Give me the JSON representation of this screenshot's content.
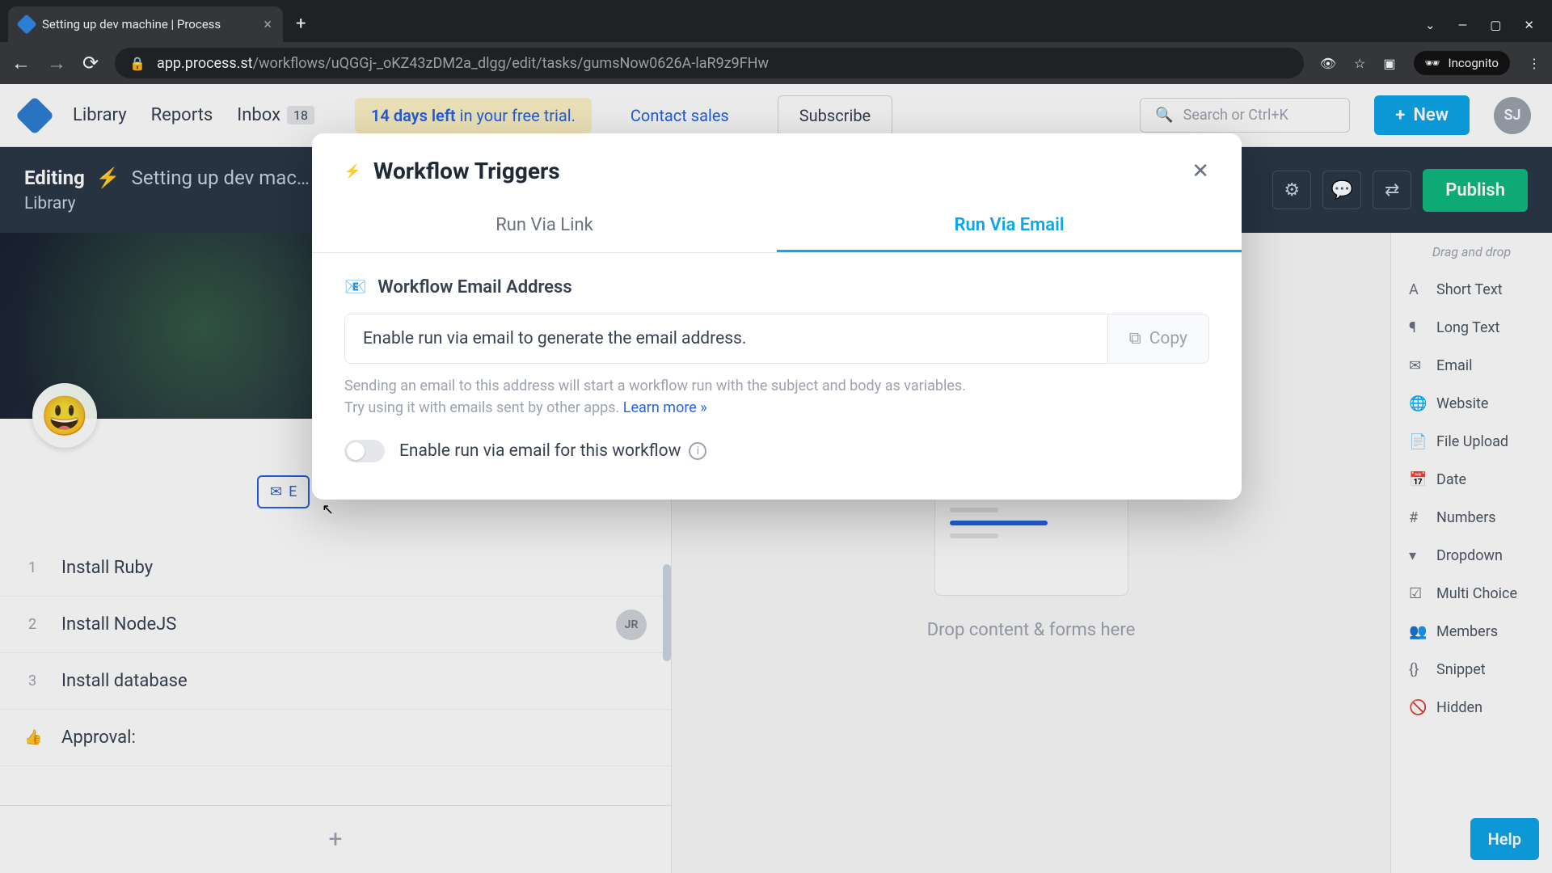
{
  "browser": {
    "tab_title": "Setting up dev machine | Process",
    "url_domain": "app.process.st",
    "url_path": "/workflows/uQGGj-_oKZ43zDM2a_dlgg/edit/tasks/gumsNow0626A-laR9z9FHw",
    "incognito_label": "Incognito"
  },
  "topbar": {
    "nav": {
      "library": "Library",
      "reports": "Reports",
      "inbox": "Inbox",
      "inbox_count": "18"
    },
    "trial_bold": "14 days left",
    "trial_rest": " in your free trial.",
    "contact": "Contact sales",
    "subscribe": "Subscribe",
    "search_placeholder": "Search or Ctrl+K",
    "new_btn": "New",
    "avatar": "SJ"
  },
  "editing": {
    "label": "Editing",
    "title": "Setting up dev mac…",
    "breadcrumb": "Library",
    "publish": "Publish"
  },
  "tasks": [
    {
      "num": "1",
      "title": "Install Ruby"
    },
    {
      "num": "2",
      "title": "Install NodeJS",
      "assignee": "JR"
    },
    {
      "num": "3",
      "title": "Install database"
    },
    {
      "num": "👍",
      "title": "Approval:",
      "thumb": true
    }
  ],
  "email_chip": "E",
  "center": {
    "drop_text": "Drop content & forms here"
  },
  "right_panel": {
    "header": "Drag and drop",
    "fields": [
      "Short Text",
      "Long Text",
      "Email",
      "Website",
      "File Upload",
      "Date",
      "Numbers",
      "Dropdown",
      "Multi Choice",
      "Members",
      "Snippet",
      "Hidden"
    ]
  },
  "modal": {
    "title": "Workflow Triggers",
    "tabs": {
      "link": "Run Via Link",
      "email": "Run Via Email"
    },
    "section_title": "Workflow Email Address",
    "email_placeholder": "Enable run via email to generate the email address.",
    "copy_label": "Copy",
    "help_line1": "Sending an email to this address will start a workflow run with the subject and body as variables.",
    "help_line2": "Try using it with emails sent by other apps. ",
    "learn_more": "Learn more »",
    "toggle_label": "Enable run via email for this workflow"
  },
  "help_fab": "Help"
}
